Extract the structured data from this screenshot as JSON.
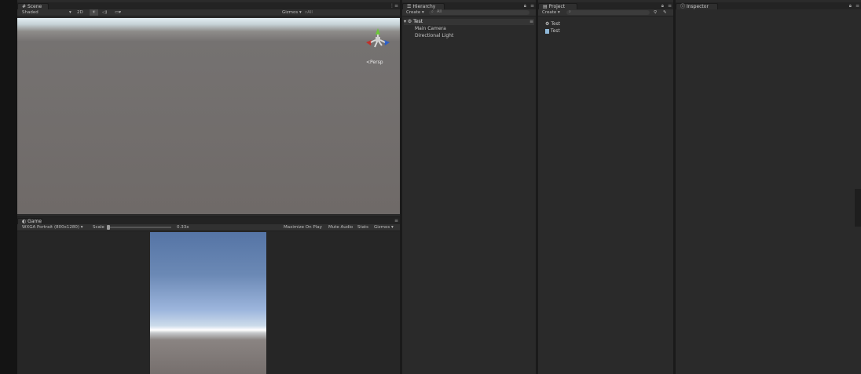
{
  "colors": {
    "panel_bg": "#2a2a2a",
    "tab_bg": "#2f2f2f",
    "sky_top": "#5574a5",
    "horizon": "#ffffff",
    "ground": "#757271",
    "gizmo_red": "#c0302a",
    "gizmo_green": "#6cc63a",
    "gizmo_blue": "#2c5fc8"
  },
  "scene": {
    "tab_label": "Scene",
    "toolbar": {
      "shading_mode": "Shaded",
      "mode_2d": "2D",
      "gizmos_label": "Gizmos",
      "all_filter": "All"
    },
    "perspective_label": "Persp"
  },
  "game": {
    "tab_label": "Game",
    "toolbar": {
      "resolution": "WXGA Portrait (800x1280)",
      "scale_label": "Scale",
      "scale_value": "0.33x",
      "maximize_on_play": "Maximize On Play",
      "mute_audio": "Mute Audio",
      "stats": "Stats",
      "gizmos": "Gizmos"
    }
  },
  "hierarchy": {
    "tab_label": "Hierarchy",
    "create_label": "Create",
    "search_placeholder": "All",
    "scene_name": "Test",
    "items": [
      {
        "label": "Main Camera"
      },
      {
        "label": "Directional Light"
      }
    ]
  },
  "project": {
    "tab_label": "Project",
    "create_label": "Create",
    "items": [
      {
        "label": "Test",
        "icon": "unity-scene-icon"
      },
      {
        "label": "Test",
        "icon": "script-file-icon"
      }
    ]
  },
  "inspector": {
    "tab_label": "Inspector"
  }
}
